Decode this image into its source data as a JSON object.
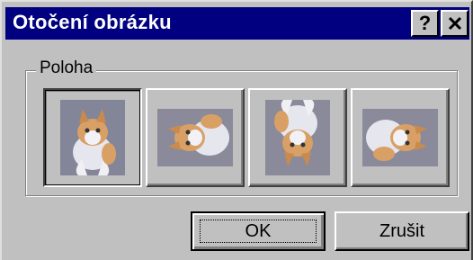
{
  "dialog": {
    "title": "Otočení obrázku",
    "help_label": "?",
    "close_label": "✕"
  },
  "group": {
    "label": "Poloha"
  },
  "positions": [
    {
      "name": "rotation-0",
      "selected": true
    },
    {
      "name": "rotation-90",
      "selected": false
    },
    {
      "name": "rotation-180",
      "selected": false
    },
    {
      "name": "rotation-270",
      "selected": false
    }
  ],
  "buttons": {
    "ok_label": "OK",
    "cancel_label": "Zrušit"
  }
}
